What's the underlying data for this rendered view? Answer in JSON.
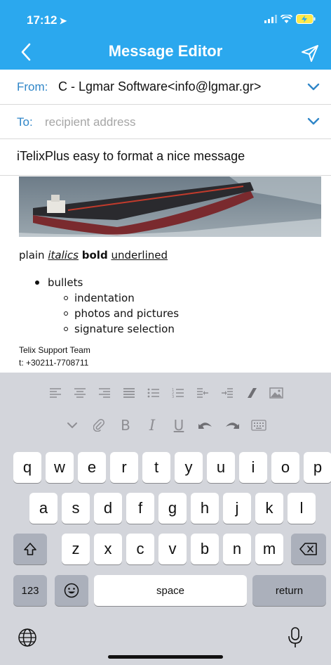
{
  "status_bar": {
    "time": "17:12"
  },
  "nav": {
    "title": "Message Editor"
  },
  "from": {
    "label": "From:",
    "value": "C - Lgmar Software<info@lgmar.gr>"
  },
  "to": {
    "label": "To:",
    "placeholder": "recipient address",
    "value": ""
  },
  "subject": {
    "value": "iTelixPlus easy to format a nice message"
  },
  "body": {
    "format_plain": "plain",
    "format_italics": "italics",
    "format_bold": "bold",
    "format_underlined": "underlined",
    "bullets": {
      "top": "bullets",
      "nested": [
        "indentation",
        "photos and pictures",
        "signature selection"
      ]
    },
    "signature_name": "Telix Support Team",
    "signature_phone": "t: +30211-7708711"
  },
  "toolbar": {
    "row1": [
      "align-left-icon",
      "align-center-icon",
      "align-right-icon",
      "align-justify-icon",
      "bullet-list-icon",
      "numbered-list-icon",
      "outdent-icon",
      "indent-icon",
      "eraser-icon",
      "image-icon"
    ],
    "row2": [
      "hide-keyboard-icon",
      "attachment-icon",
      "bold-icon",
      "italic-icon",
      "underline-icon",
      "undo-icon",
      "redo-icon",
      "keyboard-icon"
    ],
    "bold_glyph": "B",
    "italic_glyph": "I",
    "underline_glyph": "U"
  },
  "keyboard": {
    "row1": [
      "q",
      "w",
      "e",
      "r",
      "t",
      "y",
      "u",
      "i",
      "o",
      "p"
    ],
    "row2": [
      "a",
      "s",
      "d",
      "f",
      "g",
      "h",
      "j",
      "k",
      "l"
    ],
    "row3": [
      "z",
      "x",
      "c",
      "v",
      "b",
      "n",
      "m"
    ],
    "numbers_label": "123",
    "space_label": "space",
    "return_label": "return"
  },
  "colors": {
    "accent": "#2ba8ee",
    "link": "#2f86c8",
    "keyboard_bg": "#d3d5db"
  }
}
